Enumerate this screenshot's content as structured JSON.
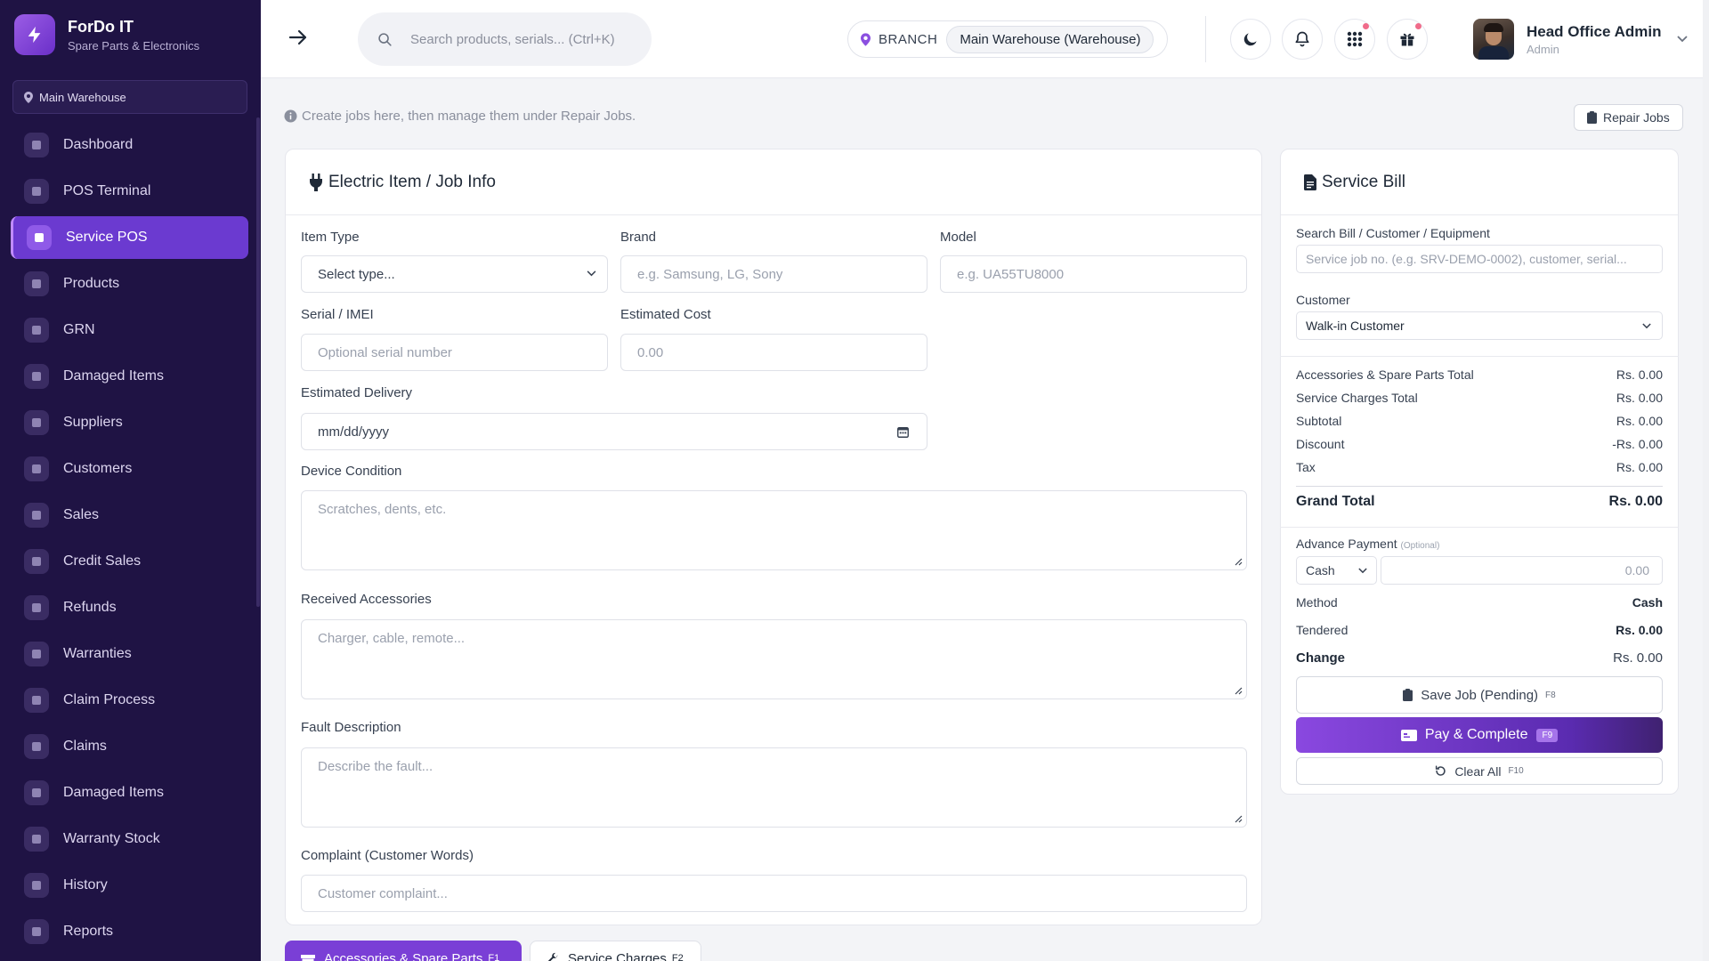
{
  "sidebar": {
    "brand_name": "ForDo IT",
    "brand_sub": "Spare Parts & Electronics",
    "branch": "Main Warehouse",
    "items": [
      {
        "label": "Dashboard",
        "icon": "chart-pie-icon"
      },
      {
        "label": "POS Terminal",
        "icon": "cash-register-icon"
      },
      {
        "label": "Service POS",
        "icon": "tools-icon",
        "active": true
      },
      {
        "label": "Products",
        "icon": "box-icon"
      },
      {
        "label": "GRN",
        "icon": "truck-loading-icon"
      },
      {
        "label": "Damaged Items",
        "icon": "warning-icon"
      },
      {
        "label": "Suppliers",
        "icon": "building-icon"
      },
      {
        "label": "Customers",
        "icon": "users-icon"
      },
      {
        "label": "Sales",
        "icon": "receipt-icon"
      },
      {
        "label": "Credit Sales",
        "icon": "credit-card-icon"
      },
      {
        "label": "Refunds",
        "icon": "undo-icon"
      },
      {
        "label": "Warranties",
        "icon": "shield-icon"
      },
      {
        "label": "Claim Process",
        "icon": "clipboard-check-icon"
      },
      {
        "label": "Claims",
        "icon": "file-claim-icon"
      },
      {
        "label": "Damaged Items",
        "icon": "damaged-boxes-icon"
      },
      {
        "label": "Warranty Stock",
        "icon": "stock-boxes-icon"
      },
      {
        "label": "History",
        "icon": "history-icon"
      },
      {
        "label": "Reports",
        "icon": "reports-icon"
      }
    ]
  },
  "topbar": {
    "search_placeholder": "Search products, serials... (Ctrl+K)",
    "branch_label": "BRANCH",
    "branch_value": "Main Warehouse (Warehouse)",
    "user_name": "Head Office Admin",
    "user_role": "Admin"
  },
  "page": {
    "info": "Create jobs here, then manage them under Repair Jobs.",
    "repair_jobs_button": "Repair Jobs"
  },
  "job_form": {
    "title": "Electric Item / Job Info",
    "item_type_label": "Item Type",
    "item_type_value": "Select type...",
    "brand_label": "Brand",
    "brand_placeholder": "e.g. Samsung, LG, Sony",
    "model_label": "Model",
    "model_placeholder": "e.g. UA55TU8000",
    "serial_label": "Serial / IMEI",
    "serial_placeholder": "Optional serial number",
    "cost_label": "Estimated Cost",
    "cost_placeholder": "0.00",
    "delivery_label": "Estimated Delivery",
    "delivery_placeholder": "mm/dd/yyyy",
    "condition_label": "Device Condition",
    "condition_placeholder": "Scratches, dents, etc.",
    "accessories_label": "Received Accessories",
    "accessories_placeholder": "Charger, cable, remote...",
    "fault_label": "Fault Description",
    "fault_placeholder": "Describe the fault...",
    "complaint_label": "Complaint (Customer Words)",
    "complaint_placeholder": "Customer complaint..."
  },
  "tabs": [
    {
      "label": "Accessories & Spare Parts",
      "key": "F1"
    },
    {
      "label": "Service Charges",
      "key": "F2"
    }
  ],
  "bill": {
    "title": "Service Bill",
    "search_label": "Search Bill / Customer / Equipment",
    "search_placeholder": "Service job no. (e.g. SRV-DEMO-0002), customer, serial...",
    "customer_label": "Customer",
    "customer_value": "Walk-in Customer",
    "rows": [
      {
        "label": "Accessories & Spare Parts Total",
        "value": "Rs. 0.00"
      },
      {
        "label": "Service Charges Total",
        "value": "Rs. 0.00"
      },
      {
        "label": "Subtotal",
        "value": "Rs. 0.00"
      },
      {
        "label": "Discount",
        "value": "-Rs. 0.00"
      },
      {
        "label": "Tax",
        "value": "Rs. 0.00"
      }
    ],
    "grand_total_label": "Grand Total",
    "grand_total_value": "Rs. 0.00",
    "advance_label": "Advance Payment",
    "advance_optional": "(Optional)",
    "advance_method": "Cash",
    "advance_amount_placeholder": "0.00",
    "method_label": "Method",
    "method_value": "Cash",
    "tendered_label": "Tendered",
    "tendered_value": "Rs. 0.00",
    "change_label": "Change",
    "change_value": "Rs. 0.00",
    "save_label": "Save Job (Pending)",
    "save_key": "F8",
    "pay_label": "Pay & Complete",
    "pay_key": "F9",
    "clear_label": "Clear All",
    "clear_key": "F10"
  },
  "colors": {
    "sidebar": "#1f1344",
    "accent": "#7a3fd6",
    "notification": "#f06b8a"
  }
}
